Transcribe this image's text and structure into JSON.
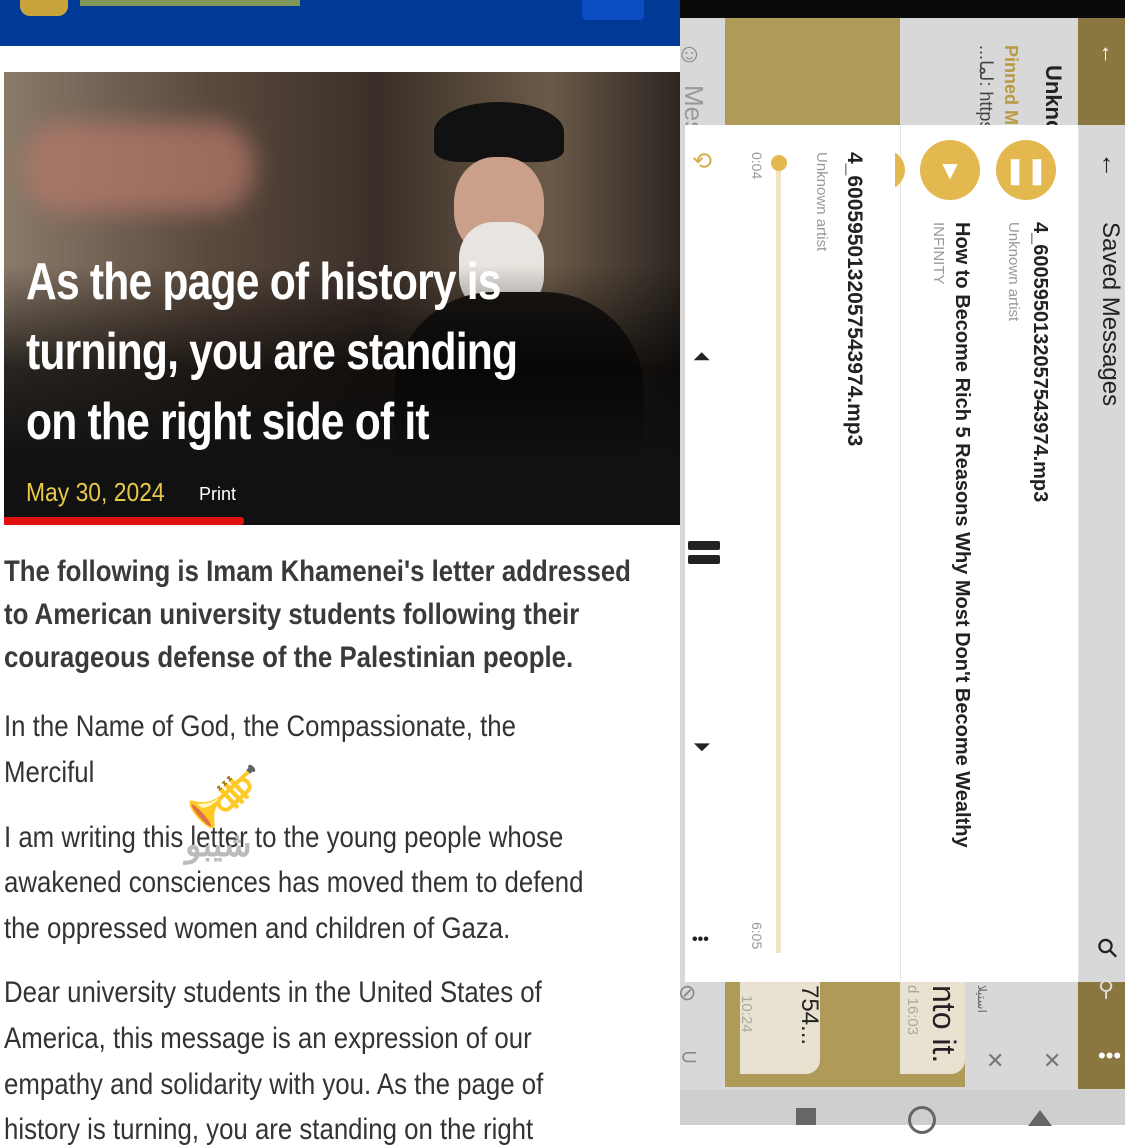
{
  "article": {
    "headline": [
      "As the page of history is",
      "turning, you are standing",
      "on the right side of it"
    ],
    "date": "May 30, 2024",
    "print_label": "Print",
    "lead": [
      "The following is Imam Khamenei's letter addressed",
      "to American university students following their",
      "courageous defense of the Palestinian people."
    ],
    "paragraphs": [
      [
        "In the Name of God, the Compassionate, the",
        "Merciful"
      ],
      [
        "I am writing this letter to the young people whose",
        "awakened consciences has moved them to defend",
        "the oppressed women and children of Gaza."
      ],
      [
        "Dear university students in the United States of",
        "America, this message is an expression of our",
        "empathy and solidarity with you. As the page of",
        "history is turning, you are standing on the right"
      ]
    ],
    "watermark": "شیبو"
  },
  "telegram": {
    "header_partial": "Unkno",
    "pinned_label": "Pinned M",
    "pinned_text": "...لما: https",
    "input_partial": "Mes",
    "bottom_msg1": "754...",
    "bottom_time1": "10:24",
    "bottom_msg2": "nto it.",
    "bottom_time2": "d 16:03",
    "bottom_arabic": "استیلا"
  },
  "player": {
    "title": "Saved Messages",
    "playlist": [
      {
        "title": "4_6005950132057543974.mp3",
        "artist": "Unknown artist",
        "state": "playing"
      },
      {
        "title": "How to Become Rich 5 Reasons Why Most Don't Become Wealthy",
        "artist": "INFINITY",
        "state": "paused"
      }
    ],
    "now_playing": {
      "title": "4_6005950132057543974.mp3",
      "artist": "Unknown artist"
    },
    "elapsed": "0:04",
    "duration": "6:05",
    "progress_fraction": 0.011,
    "accent": "#e3b84f"
  }
}
